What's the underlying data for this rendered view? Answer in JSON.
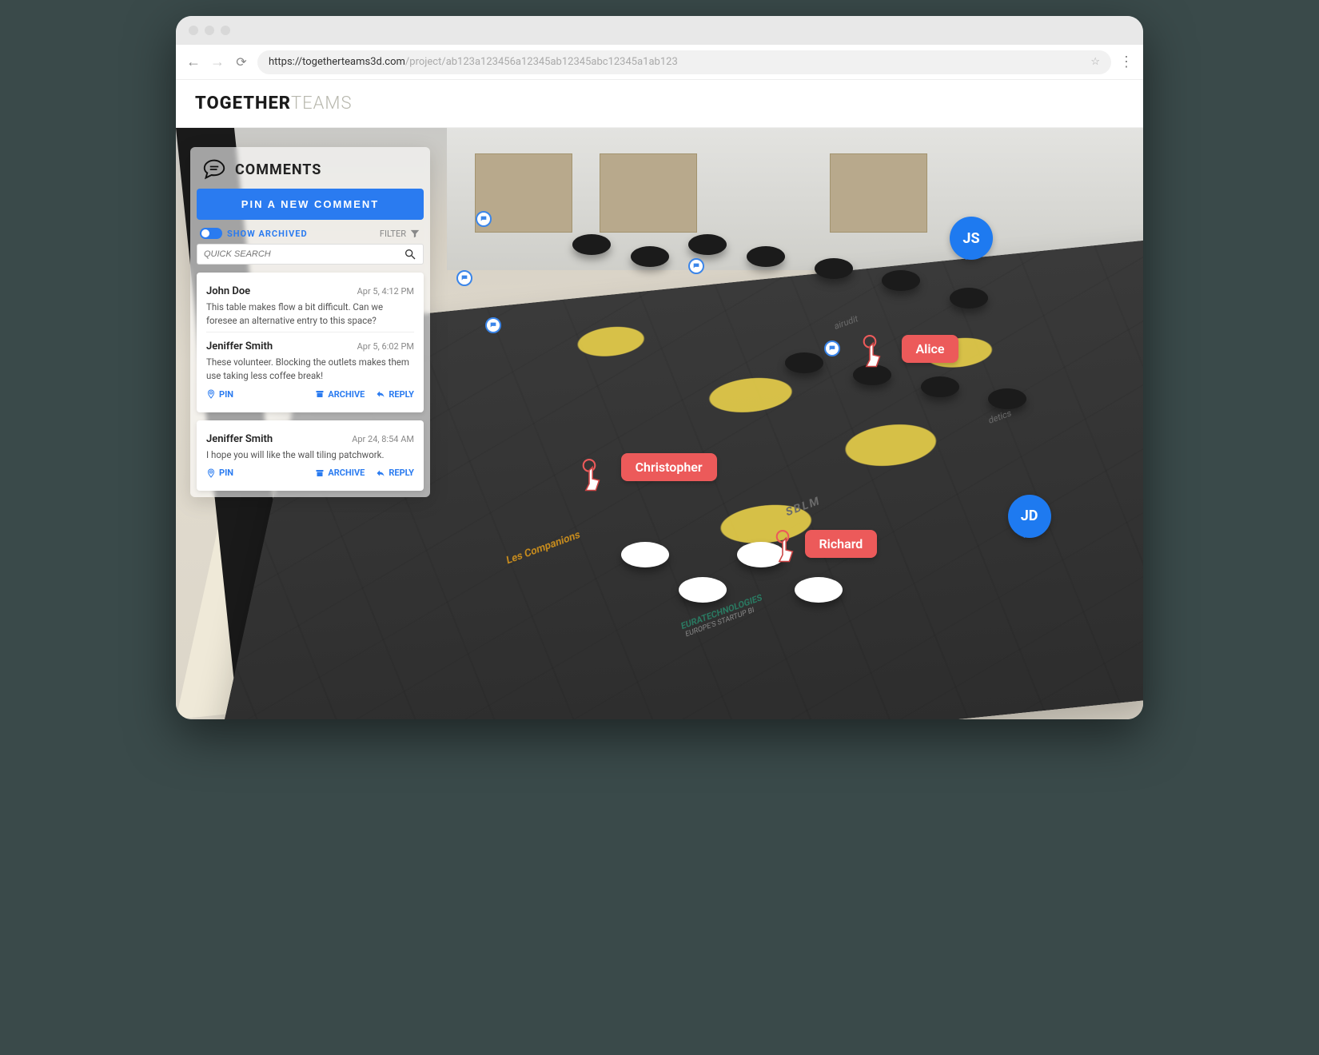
{
  "browser": {
    "url_host": "https://togetherteams3d.com",
    "url_path": "/project/ab123a123456a12345ab12345abc12345a1ab123"
  },
  "brand": {
    "strong": "TOGETHER",
    "light": "TEAMS"
  },
  "panel": {
    "title": "COMMENTS",
    "pin_button": "PIN A NEW COMMENT",
    "show_archived": "SHOW ARCHIVED",
    "filter_label": "FILTER",
    "search_placeholder": "QUICK SEARCH"
  },
  "actions": {
    "pin": "PIN",
    "archive": "ARCHIVE",
    "reply": "REPLY"
  },
  "threads": [
    {
      "comments": [
        {
          "author": "John Doe",
          "time": "Apr 5, 4:12 PM",
          "body": "This table makes flow a bit difficult. Can we foresee an alternative entry to this space?"
        },
        {
          "author": "Jeniffer Smith",
          "time": "Apr 5, 6:02 PM",
          "body": "These volunteer. Blocking the outlets makes them use taking less coffee break!"
        }
      ]
    },
    {
      "comments": [
        {
          "author": "Jeniffer Smith",
          "time": "Apr 24, 8:54 AM",
          "body": "I hope you will like the wall tiling patchwork."
        }
      ]
    }
  ],
  "collaborators": {
    "christopher": "Christopher",
    "alice": "Alice",
    "richard": "Richard"
  },
  "avatars": {
    "js": "JS",
    "jd": "JD"
  },
  "colors": {
    "primary": "#2a7bf0",
    "tag": "#ec5a5a"
  },
  "floor_labels": {
    "companions": "Les Companions",
    "euratech": "EURATECHNOLOGIES",
    "euratech_sub": "EUROPE'S STARTUP BI",
    "sblm": "SBLM",
    "detics": "detics",
    "airudit": "airudit"
  }
}
